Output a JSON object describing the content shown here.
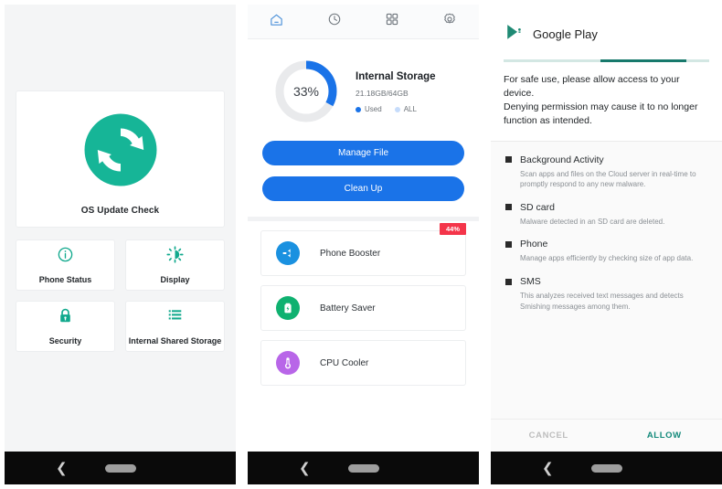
{
  "panel1": {
    "name": "os-update-check-screen",
    "background": "#f4f5f6",
    "accent": "#16b597",
    "hero": {
      "icon": "refresh-sync-icon",
      "label": "OS Update Check"
    },
    "tiles": [
      {
        "icon": "info-circle-icon",
        "label": "Phone Status"
      },
      {
        "icon": "brightness-icon",
        "label": "Display"
      },
      {
        "icon": "lock-icon",
        "label": "Security"
      },
      {
        "icon": "list-storage-icon",
        "label": "Internal Shared Storage"
      }
    ],
    "navbar": {
      "back": "back-chevron-icon",
      "home": "home-pill-indicator"
    }
  },
  "panel2": {
    "name": "cleaner-home-screen",
    "accent": "#1a73e8",
    "tabs": [
      {
        "icon": "home-icon",
        "label": "Home",
        "active": true
      },
      {
        "icon": "clock-history-icon",
        "label": "History",
        "active": false
      },
      {
        "icon": "apps-grid-icon",
        "label": "Apps",
        "active": false
      },
      {
        "icon": "gear-icon",
        "label": "Settings",
        "active": false
      }
    ],
    "storage": {
      "percent_label": "33%",
      "percent_value": 33,
      "title": "Internal Storage",
      "subtitle": "21.18GB/64GB",
      "used_gb": 21.18,
      "total_gb": 64,
      "legend": [
        {
          "label": "Used",
          "color": "#1a73e8"
        },
        {
          "label": "ALL",
          "color": "#c6dcfb"
        }
      ],
      "ring_used_color": "#1a73e8",
      "ring_track_color": "#e9eaec"
    },
    "buttons": [
      {
        "label": "Manage File",
        "name": "manage-file-button"
      },
      {
        "label": "Clean Up",
        "name": "clean-up-button"
      }
    ],
    "features": [
      {
        "icon": "phone-booster-icon",
        "label": "Phone Booster",
        "icon_color": "#1a91e0",
        "badge": "44%",
        "badge_color": "#f4354a"
      },
      {
        "icon": "battery-saver-icon",
        "label": "Battery Saver",
        "icon_color": "#0fb170",
        "badge": ""
      },
      {
        "icon": "cpu-cooler-icon",
        "label": "CPU Cooler",
        "icon_color": "#b866e8",
        "badge": ""
      }
    ],
    "navbar": {
      "back": "back-chevron-icon",
      "home": "home-pill-indicator"
    }
  },
  "panel3": {
    "name": "google-play-permission-dialog",
    "accent": "#12897a",
    "header": {
      "icon": "google-play-icon",
      "title": "Google Play"
    },
    "progress": {
      "track_color": "#d3e7e3",
      "bar_color": "#17796c"
    },
    "message": "For safe use, please allow access to your device.\nDenying permission may cause it to no longer function as intended.",
    "permissions": [
      {
        "name": "Background Activity",
        "description": "Scan apps and files on the Cloud server in real-time to promptly respond to any new malware."
      },
      {
        "name": "SD card",
        "description": "Malware detected in an SD card are deleted."
      },
      {
        "name": "Phone",
        "description": "Manage apps efficiently by checking size of app data."
      },
      {
        "name": "SMS",
        "description": "This analyzes received text messages and detects Smishing messages among them."
      }
    ],
    "actions": {
      "cancel": "CANCEL",
      "allow": "ALLOW"
    },
    "navbar": {
      "back": "back-chevron-icon",
      "home": "home-pill-indicator"
    }
  }
}
